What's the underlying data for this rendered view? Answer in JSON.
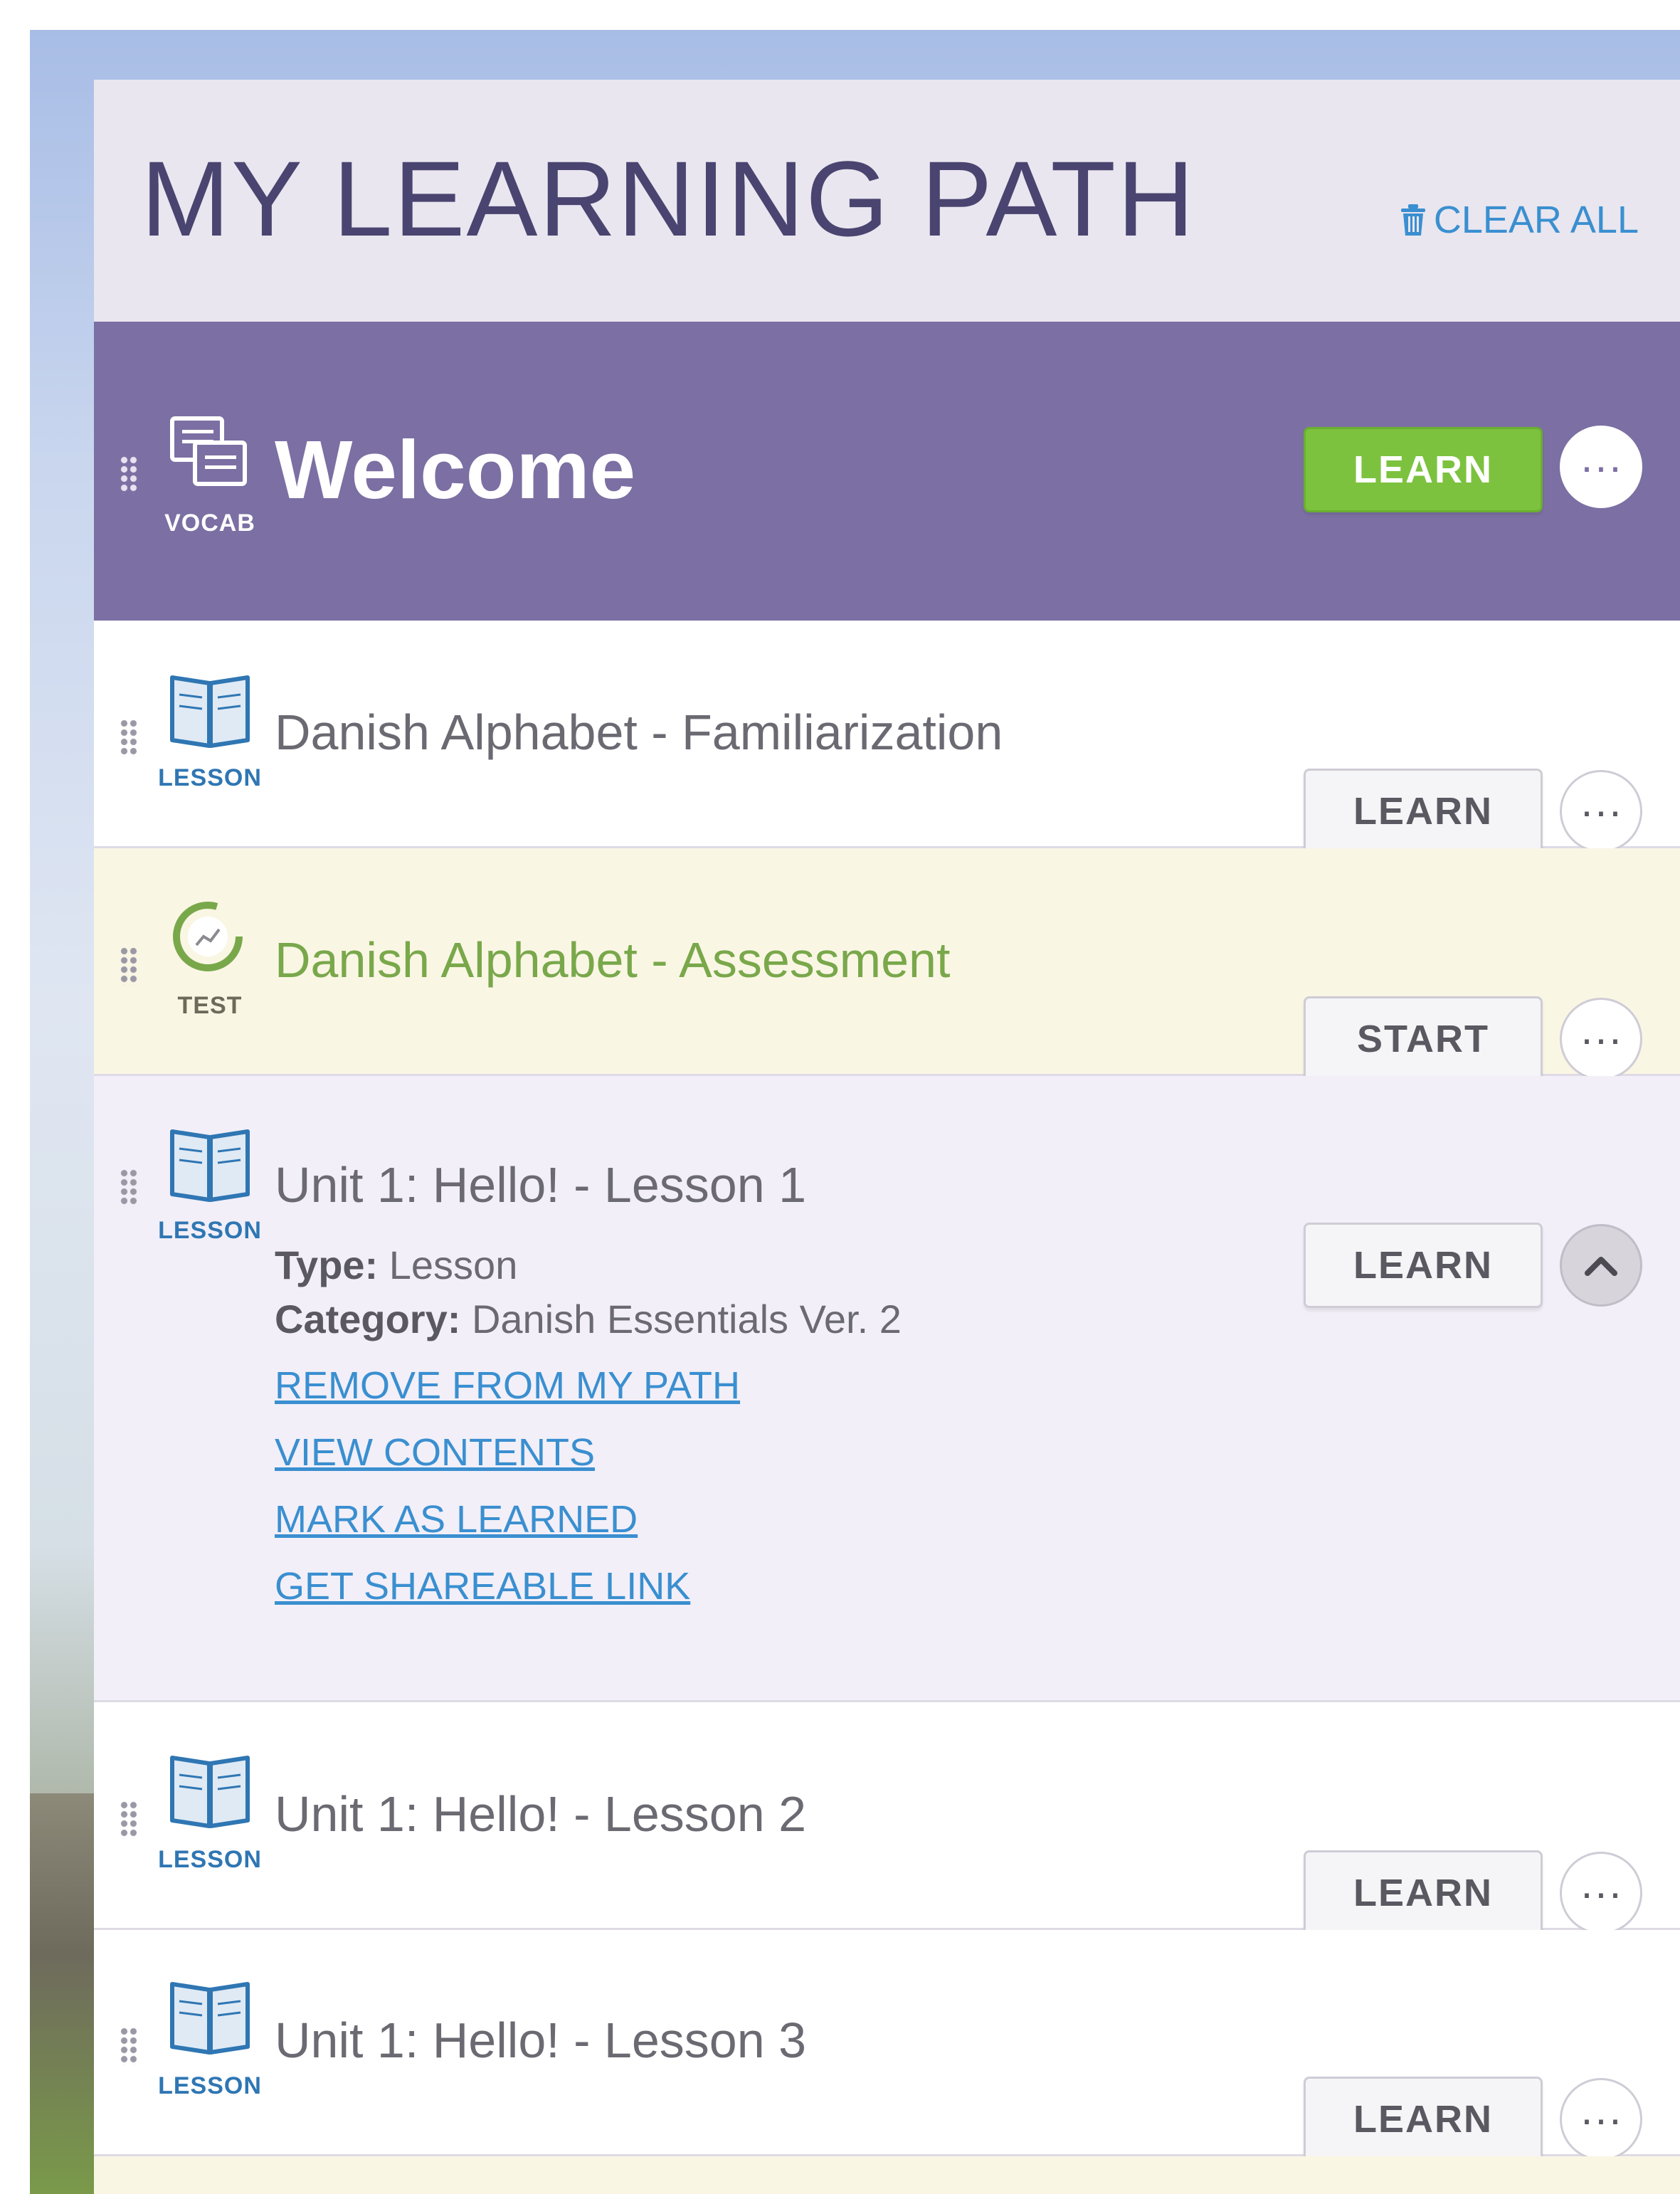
{
  "panel": {
    "title": "MY LEARNING PATH",
    "clear_all_label": "CLEAR ALL"
  },
  "items": [
    {
      "type_label": "VOCAB",
      "title": "Welcome",
      "button_label": "LEARN",
      "more_label": "···"
    },
    {
      "type_label": "LESSON",
      "title": "Danish Alphabet - Familiarization",
      "button_label": "LEARN",
      "more_label": "···"
    },
    {
      "type_label": "TEST",
      "title": "Danish Alphabet - Assessment",
      "button_label": "START",
      "more_label": "···"
    },
    {
      "type_label": "LESSON",
      "title": "Unit 1: Hello! - Lesson 1",
      "button_label": "LEARN",
      "type_key": "Type:",
      "type_value": "Lesson",
      "category_key": "Category:",
      "category_value": "Danish Essentials Ver. 2",
      "links": [
        "REMOVE FROM MY PATH",
        "VIEW CONTENTS",
        "MARK AS LEARNED",
        "GET SHAREABLE LINK"
      ]
    },
    {
      "type_label": "LESSON",
      "title": "Unit 1: Hello! - Lesson 2",
      "button_label": "LEARN",
      "more_label": "···"
    },
    {
      "type_label": "LESSON",
      "title": "Unit 1: Hello! - Lesson 3",
      "button_label": "LEARN",
      "more_label": "···"
    }
  ],
  "colors": {
    "header_bg": "#e9e6ef",
    "title": "#4a4470",
    "link": "#3a8fd0",
    "welcome_bg": "#7c6fa3",
    "learn_green": "#7cc23f",
    "test_bg": "#faf6e4",
    "test_text": "#79a84b",
    "expanded_bg": "#f2eff8"
  },
  "icons": [
    "trash-icon",
    "drag-handle-icon",
    "vocab-icon",
    "book-icon",
    "test-progress-icon",
    "more-icon",
    "chevron-up-icon"
  ]
}
